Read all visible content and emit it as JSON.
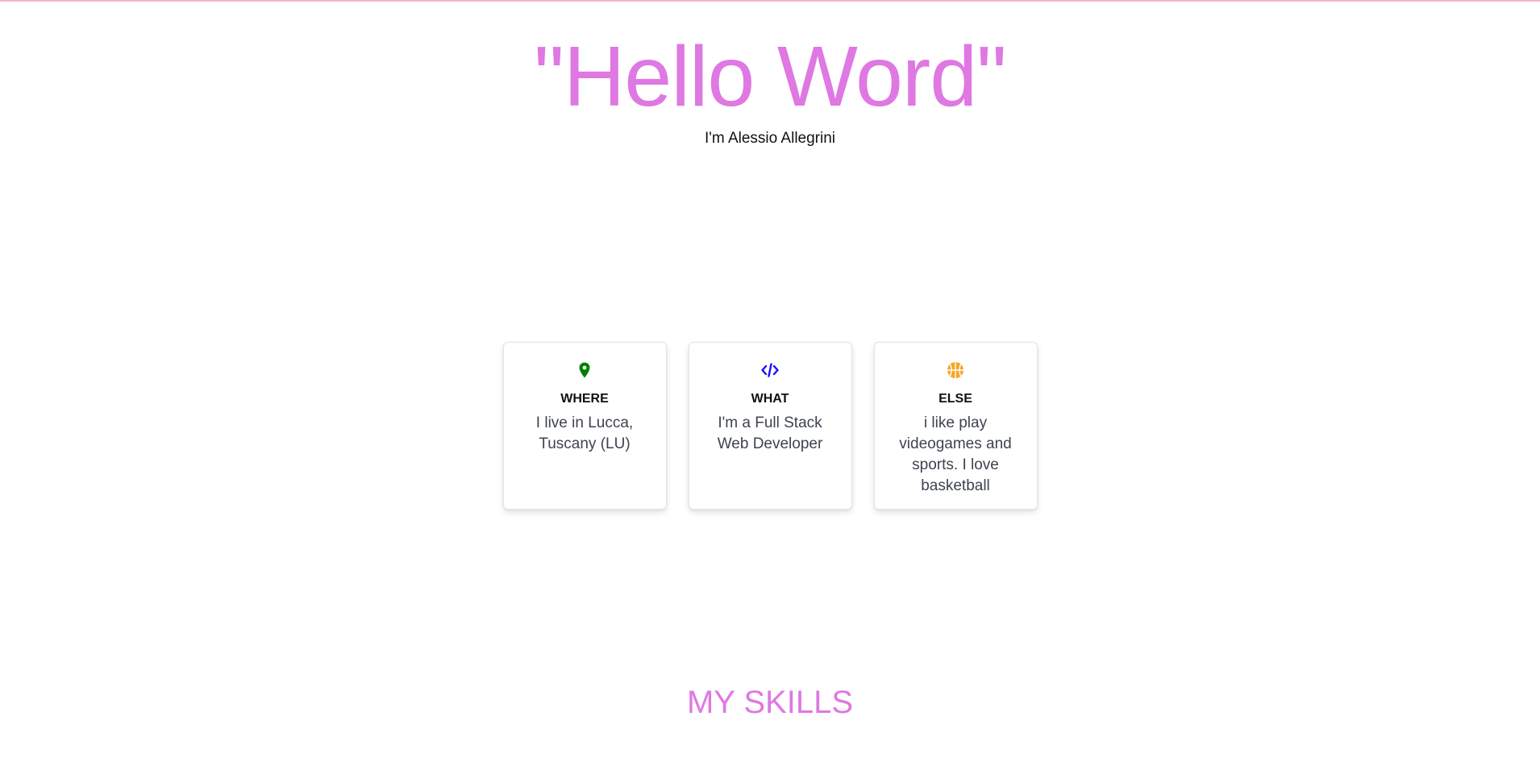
{
  "hero": {
    "title": "\"Hello Word\"",
    "subtitle": "I'm Alessio Allegrini"
  },
  "cards": [
    {
      "icon": "map-pin-icon",
      "icon_color": "#008000",
      "title": "WHERE",
      "text": "I live in Lucca, Tuscany (LU)"
    },
    {
      "icon": "code-icon",
      "icon_color": "#1a0dff",
      "title": "WHAT",
      "text": "I'm a Full Stack Web Developer"
    },
    {
      "icon": "basketball-icon",
      "icon_color": "#f5a623",
      "title": "ELSE",
      "text": "i like play videogames and sports. I love basketball"
    }
  ],
  "skills": {
    "heading": "MY SKILLS"
  },
  "colors": {
    "accent": "#df78e2",
    "top_rule": "#f4b7c8"
  }
}
